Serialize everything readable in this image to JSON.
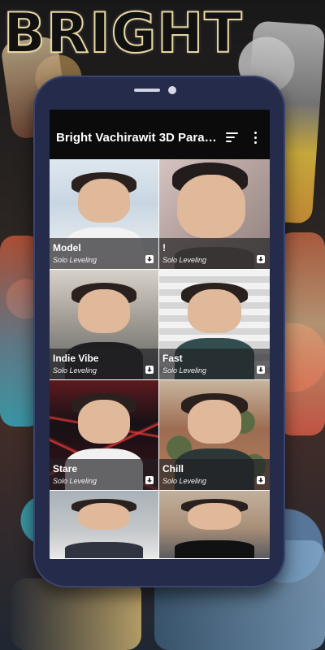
{
  "background": {
    "headline": "BRIGHT"
  },
  "app": {
    "title": "Bright Vachirawit 3D Paral...",
    "actions": {
      "sort_icon": "sort-icon",
      "more_icon": "more-vert-icon"
    }
  },
  "wallpapers": [
    {
      "name": "Model",
      "subtitle": "Solo Leveling"
    },
    {
      "name": "!",
      "subtitle": "Solo Leveling"
    },
    {
      "name": "Indie Vibe",
      "subtitle": "Solo Leveling"
    },
    {
      "name": "Fast",
      "subtitle": "Solo Leveling"
    },
    {
      "name": "Stare",
      "subtitle": "Solo Leveling"
    },
    {
      "name": "Chill",
      "subtitle": "Solo Leveling"
    },
    {
      "name": "",
      "subtitle": ""
    },
    {
      "name": "",
      "subtitle": ""
    }
  ],
  "colors": {
    "phone_frame": "#242b4b",
    "app_bar": "#0b0b0c",
    "overlay": "#202024"
  }
}
